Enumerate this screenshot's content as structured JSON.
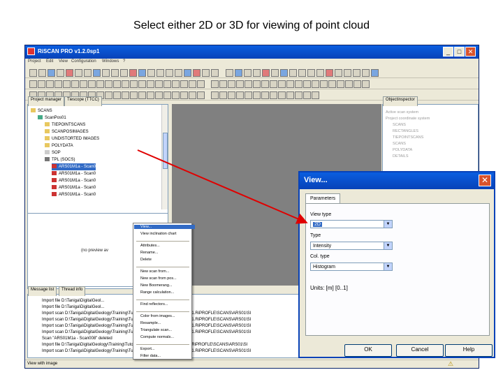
{
  "slide_title": "Select either 2D or 3D for viewing of point cloud",
  "app": {
    "title": "RiSCAN PRO v1.2.0sp1",
    "window_buttons": {
      "minimize": "_",
      "maximize": "□",
      "close": "✕"
    },
    "menu": [
      "Project",
      "Edit",
      "View",
      "Configuration",
      "Windows",
      "?"
    ],
    "project_tabs": [
      "Project manager",
      "Tiescope (TTCC)"
    ],
    "tree": [
      {
        "label": "SCANS",
        "icon": "folder-icon"
      },
      {
        "label": "ScanPos01",
        "icon": "scanpos-icon"
      },
      {
        "label": "TIEPOINTSCANS",
        "icon": "folder-icon"
      },
      {
        "label": "SCANPOSIMAGES",
        "icon": "folder-icon"
      },
      {
        "label": "UNDISTORTED IMAGES",
        "icon": "folder-icon"
      },
      {
        "label": "POLYDATA",
        "icon": "folder-icon"
      },
      {
        "label": "SOP",
        "icon": "doc-icon"
      },
      {
        "label": "TPL (SOCS)",
        "icon": "tpl-icon"
      },
      {
        "label": "ARS01M1a - Scan0",
        "icon": "scan-icon"
      },
      {
        "label": "ARS01M1a - Scan0",
        "icon": "scan-icon"
      },
      {
        "label": "ARS01M1a - Scan0",
        "icon": "scan-icon"
      },
      {
        "label": "ARS01M1a - Scan0",
        "icon": "scan-icon"
      },
      {
        "label": "ARS01M1a - Scan0",
        "icon": "scan-icon"
      }
    ],
    "no_preview": "(no preview av",
    "object_inspector_tab": "Objectinspector",
    "object_inspector_rows": [
      "Active scan system",
      "Project coordinate system",
      "SCANS",
      "RECTANGLES",
      "TIEPOINTSCANS",
      "SCANS",
      "POLYDATA",
      "DETAILS"
    ],
    "log_tabs": [
      "Message list",
      "Thread info"
    ],
    "log_lines": [
      "Import file D:\\Taniga\\DigitalGeol...",
      "Import file D:\\Taniga\\DigitalGeol...",
      "Import scan D:\\Taniga\\DigitalGeology\\Training\\Tutorial Files\\AntiSynClines\\ARS01.RiPROFLE\\SCANS\\ARS01\\SI",
      "Import scan D:\\Taniga\\DigitalGeology\\Training\\Tutorial Files\\AntiSynClines\\ARS01.RiPROFLE\\SCANS\\ARS01\\SI",
      "Import scan D:\\Taniga\\DigitalGeology\\Training\\Tutorial Files\\AntiSynClines\\ARS01.RiPROFLE\\SCANS\\ARS01\\SI",
      "Import scan D:\\Taniga\\DigitalGeology\\Training\\Tutorial Files\\AntiSynClines\\ARS01.RiPROFLE\\SCANS\\ARS01\\SI",
      "Scan \"ARS01M1a - Scan008\" deleted",
      "Import file D:\\Taniga\\DigitalGeology\\Training\\Tutorial Files\\AntiSynClines\\ARS01.RiPROFLE\\SCANS\\ARS01\\SI",
      "Import scan D:\\Taniga\\DigitalGeology\\Training\\Tutorial Files\\AntiSynClines\\ARS01.RiPROFLE\\SCANS\\ARS01\\SI"
    ],
    "status_text": "View with image"
  },
  "context_menu": {
    "items": [
      {
        "label": "View...",
        "active": true
      },
      {
        "label": "View inclination chart",
        "active": false
      },
      {
        "sep": true
      },
      {
        "label": "Attributes...",
        "active": false
      },
      {
        "label": "Rename...",
        "active": false
      },
      {
        "label": "Delete",
        "active": false
      },
      {
        "sep": true
      },
      {
        "label": "New scan from...",
        "active": false
      },
      {
        "label": "New scan from pos...",
        "active": false
      },
      {
        "label": "New Boomerang...",
        "active": false
      },
      {
        "label": "Range calculation...",
        "active": false
      },
      {
        "sep": true
      },
      {
        "label": "Find reflectors...",
        "active": false
      },
      {
        "sep": true
      },
      {
        "label": "Color from images...",
        "active": false
      },
      {
        "label": "Resample...",
        "active": false
      },
      {
        "label": "Triangulate scan...",
        "active": false
      },
      {
        "label": "Compute normals...",
        "active": false
      },
      {
        "sep": true
      },
      {
        "label": "Export...",
        "active": false
      },
      {
        "label": "Filter data...",
        "active": false
      }
    ]
  },
  "dialog": {
    "title": "View...",
    "tab": "Parameters",
    "view_type_label": "View type",
    "view_type_value": "2D",
    "type_label": "Type",
    "type_value": "Intensity",
    "color_type_label": "Col. type",
    "color_type_value": "Histogram",
    "units": "Units: [m] [0..1]",
    "buttons": {
      "ok": "OK",
      "cancel": "Cancel",
      "help": "Help"
    }
  },
  "colors": {
    "titlebar": "#0842b8",
    "selection": "#316ac5",
    "arrow": "#e00000",
    "viewport": "#808080"
  }
}
